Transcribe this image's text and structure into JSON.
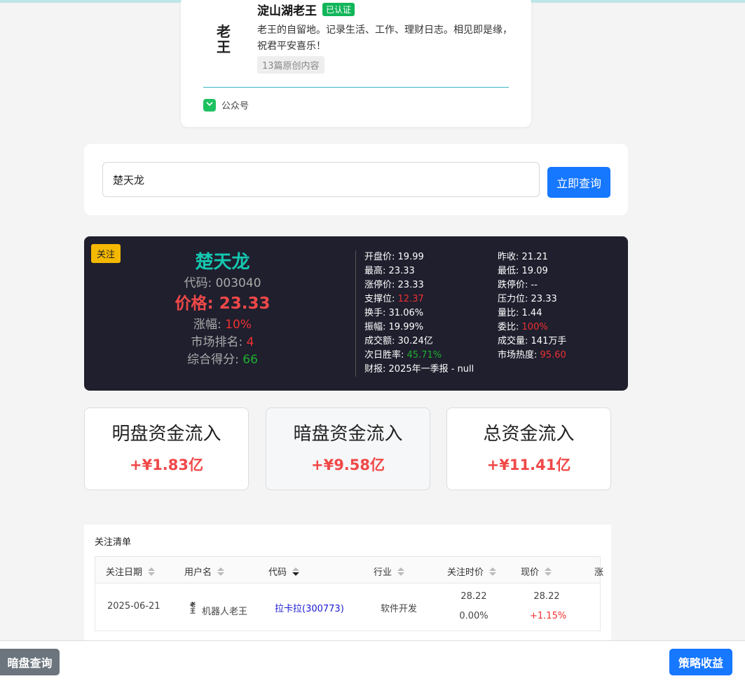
{
  "profile": {
    "name": "淀山湖老王",
    "verified_label": "已认证",
    "avatar_glyph": "老王",
    "description": "老王的自留地。记录生活、工作、理财日志。相见即是缘，祝君平安喜乐！",
    "tag": "13篇原创内容",
    "footer_label": "公众号"
  },
  "search": {
    "value": "楚天龙",
    "button_label": "立即查询"
  },
  "stock": {
    "badge": "关注",
    "name": "楚天龙",
    "code_label": "代码:",
    "code": "003040",
    "price_label": "价格:",
    "price": "23.33",
    "change_label": "涨幅:",
    "change": "10%",
    "rank_label": "市场排名:",
    "rank": "4",
    "score_label": "综合得分:",
    "score": "66",
    "details": [
      {
        "label": "开盘价:",
        "value": "19.99",
        "tone": ""
      },
      {
        "label": "昨收:",
        "value": "21.21",
        "tone": ""
      },
      {
        "label": "最高:",
        "value": "23.33",
        "tone": ""
      },
      {
        "label": "最低:",
        "value": "19.09",
        "tone": ""
      },
      {
        "label": "涨停价:",
        "value": "23.33",
        "tone": ""
      },
      {
        "label": "跌停价:",
        "value": "--",
        "tone": ""
      },
      {
        "label": "支撑位:",
        "value": "12.37",
        "tone": "red"
      },
      {
        "label": "压力位:",
        "value": "23.33",
        "tone": ""
      },
      {
        "label": "换手:",
        "value": "31.06%",
        "tone": ""
      },
      {
        "label": "量比:",
        "value": "1.44",
        "tone": ""
      },
      {
        "label": "振幅:",
        "value": "19.99%",
        "tone": ""
      },
      {
        "label": "委比:",
        "value": "100%",
        "tone": "red"
      },
      {
        "label": "成交额:",
        "value": "30.24亿",
        "tone": ""
      },
      {
        "label": "成交量:",
        "value": "141万手",
        "tone": ""
      },
      {
        "label": "次日胜率:",
        "value": "45.71%",
        "tone": "green"
      },
      {
        "label": "市场热度:",
        "value": "95.60",
        "tone": "red"
      },
      {
        "label": "财报:",
        "value": "2025年一季报 - null",
        "tone": ""
      }
    ]
  },
  "flows": [
    {
      "title": "明盘资金流入",
      "value": "+¥1.83亿"
    },
    {
      "title": "暗盘资金流入",
      "value": "+¥9.58亿"
    },
    {
      "title": "总资金流入",
      "value": "+¥11.41亿"
    }
  ],
  "watchlist": {
    "title": "关注清单",
    "columns": [
      "关注日期",
      "用户名",
      "代码",
      "行业",
      "关注时价",
      "现价",
      "涨"
    ],
    "rows": [
      {
        "date": "2025-06-21",
        "user": "机器人老王",
        "user_avatar": "老王",
        "code": "拉卡拉(300773)",
        "industry": "软件开发",
        "follow_price": "28.22",
        "follow_change": "0.00%",
        "current_price": "28.22",
        "current_change": "+1.15%"
      }
    ]
  },
  "bottom": {
    "left_button": "暗盘查询",
    "right_button": "策略收益"
  },
  "colors": {
    "accent": "#1677ff",
    "up_red": "#f04848",
    "stock_name": "#14c8b0",
    "card_dark": "#1f1f2e",
    "badge_yellow": "#f5b800",
    "wechat_green": "#1ec160"
  }
}
